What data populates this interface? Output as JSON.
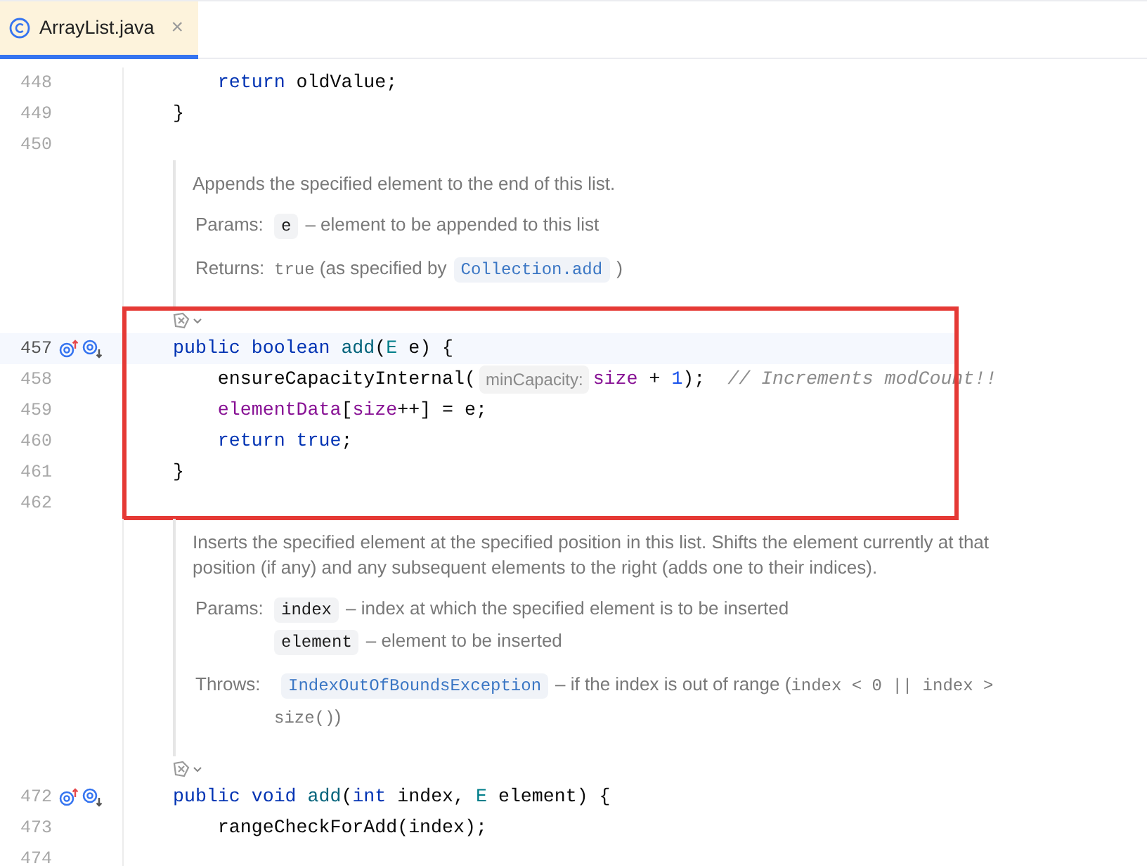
{
  "tab": {
    "title": "ArrayList.java",
    "close": "×",
    "selected": true
  },
  "blocks": [
    {
      "kind": "code",
      "lines": [
        {
          "number": "448",
          "tokens": [
            {
              "kind": "keyword",
              "text": "    return"
            },
            {
              "kind": "plain",
              "text": " oldValue;"
            }
          ]
        },
        {
          "number": "449",
          "tokens": [
            {
              "kind": "plain",
              "text": "}"
            }
          ]
        },
        {
          "number": "450"
        }
      ]
    },
    {
      "kind": "doc",
      "description": "Appends the specified element to the end of this list.",
      "sections": [
        {
          "label": "Params:",
          "entries": [
            [
              {
                "kind": "code",
                "text": "e"
              },
              {
                "kind": "text",
                "text": "– element to be appended to this list"
              }
            ]
          ]
        },
        {
          "label": "Returns:",
          "entries": [
            [
              {
                "kind": "mono",
                "text": "true"
              },
              {
                "kind": "text",
                "text": " (as specified by"
              },
              {
                "kind": "link",
                "text": "Collection.add"
              },
              {
                "kind": "text",
                "text": ")"
              }
            ]
          ]
        }
      ]
    },
    {
      "kind": "code",
      "outlined": true,
      "inlay_icon": true,
      "lines": [
        {
          "number": "457",
          "current": true,
          "markers": true,
          "tokens": [
            {
              "kind": "keyword",
              "text": "public boolean "
            },
            {
              "kind": "method",
              "text": "add"
            },
            {
              "kind": "plain",
              "text": "("
            },
            {
              "kind": "type",
              "text": "E"
            },
            {
              "kind": "plain",
              "text": " e) {"
            }
          ]
        },
        {
          "number": "458",
          "tokens": [
            {
              "kind": "plain",
              "text": "    ensureCapacityInternal("
            },
            {
              "kind": "hint",
              "text": "minCapacity:"
            },
            {
              "kind": "field",
              "text": "size"
            },
            {
              "kind": "plain",
              "text": " + "
            },
            {
              "kind": "number",
              "text": "1"
            },
            {
              "kind": "plain",
              "text": ");  "
            },
            {
              "kind": "comment",
              "text": "// Increments modCount!!"
            }
          ]
        },
        {
          "number": "459",
          "tokens": [
            {
              "kind": "field",
              "text": "    elementData"
            },
            {
              "kind": "plain",
              "text": "["
            },
            {
              "kind": "field",
              "text": "size"
            },
            {
              "kind": "plain",
              "text": "++] = e;"
            }
          ]
        },
        {
          "number": "460",
          "tokens": [
            {
              "kind": "keyword",
              "text": "    return true"
            },
            {
              "kind": "plain",
              "text": ";"
            }
          ]
        },
        {
          "number": "461",
          "tokens": [
            {
              "kind": "plain",
              "text": "}"
            }
          ]
        },
        {
          "number": "462"
        }
      ]
    },
    {
      "kind": "doc",
      "description": "Inserts the specified element at the specified position in this list. Shifts the element currently at that position (if any) and any subsequent elements to the right (adds one to their indices).",
      "sections": [
        {
          "label": "Params:",
          "entries": [
            [
              {
                "kind": "code",
                "text": "index"
              },
              {
                "kind": "text",
                "text": "– index at which the specified element is to be inserted"
              }
            ],
            [
              {
                "kind": "code",
                "text": "element"
              },
              {
                "kind": "text",
                "text": "– element to be inserted"
              }
            ]
          ]
        },
        {
          "label": "Throws:",
          "entries": [
            [
              {
                "kind": "link",
                "text": "IndexOutOfBoundsException"
              },
              {
                "kind": "text",
                "text": "– if the index is out of range ("
              },
              {
                "kind": "mono",
                "text": "index < 0 || index > size()"
              },
              {
                "kind": "text",
                "text": ")"
              }
            ]
          ]
        }
      ]
    },
    {
      "kind": "code",
      "inlay_icon": true,
      "lines": [
        {
          "number": "472",
          "markers": true,
          "tokens": [
            {
              "kind": "keyword",
              "text": "public void "
            },
            {
              "kind": "method",
              "text": "add"
            },
            {
              "kind": "plain",
              "text": "("
            },
            {
              "kind": "keyword",
              "text": "int"
            },
            {
              "kind": "plain",
              "text": " index, "
            },
            {
              "kind": "type",
              "text": "E"
            },
            {
              "kind": "plain",
              "text": " element) {"
            }
          ]
        },
        {
          "number": "473",
          "tokens": [
            {
              "kind": "plain",
              "text": "    rangeCheckForAdd(index);"
            }
          ]
        },
        {
          "number": "474"
        }
      ]
    }
  ]
}
